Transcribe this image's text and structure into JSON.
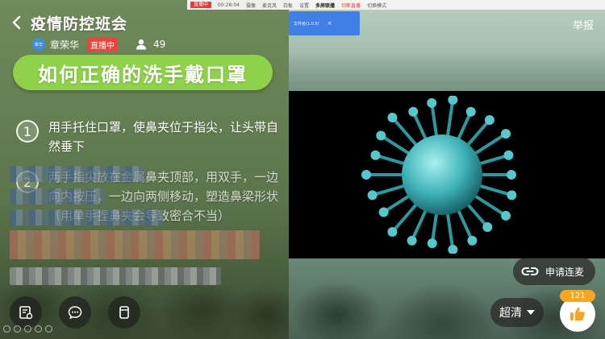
{
  "header": {
    "title": "疫情防控班会",
    "report_label": "举报"
  },
  "host": {
    "avatar_text": "章华",
    "name": "章荣华",
    "live_badge": "直播中",
    "viewer_count": "49"
  },
  "toolbar": {
    "live_tag": "直播中",
    "timer": "00:28:04",
    "items": [
      "摄像",
      "麦克风",
      "白板",
      "设置",
      "多屏联播",
      "切换模式"
    ],
    "recording_label": "切断直播"
  },
  "popup": {
    "text": "文件名(1.0.5)",
    "close": "×"
  },
  "slide": {
    "title": "如何正确的洗手戴口罩",
    "step1_number": "1",
    "step1_text": "用手托住口罩，使鼻夹位于指尖，让头带自然垂下",
    "step2_number": "2",
    "step2_text": "两手指尖放在金属鼻夹顶部，用双手，一边向内按压，一边向两侧移动，塑造鼻梁形状（用单手捏鼻夹会导致密合不当）"
  },
  "controls": {
    "apply_mic_label": "申请连麦",
    "quality_label": "超清",
    "like_count": "121"
  },
  "icons": {
    "back": "chevron-left-icon",
    "viewer": "person-icon",
    "courseware": "courseware-icon",
    "comment": "chat-bubble-icon",
    "cup": "cup-icon",
    "link": "link-icon",
    "dropdown": "caret-down-icon",
    "like": "thumbs-up-icon"
  },
  "colors": {
    "title_pill": "#8fd14a",
    "live_badge": "#e8453c",
    "like_badge": "#f5a623",
    "avatar": "#3b8de0"
  }
}
